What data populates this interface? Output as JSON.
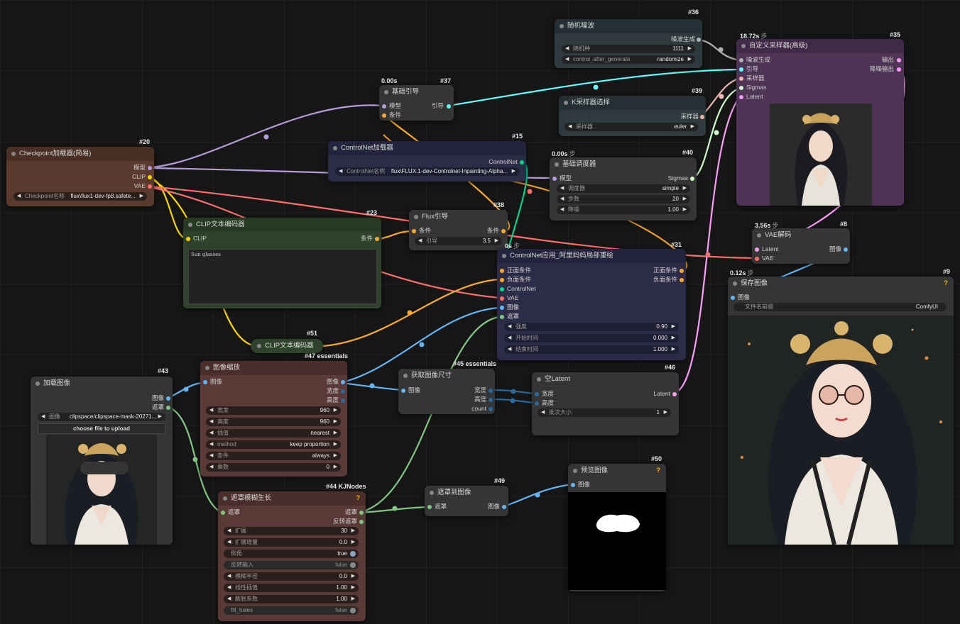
{
  "nodes": {
    "n36": {
      "id": "#36",
      "title": "随机噪波",
      "out1": "噪波生成",
      "w_seed_label": "随机种",
      "w_seed_value": "1111",
      "w_cag_label": "control_after_generate",
      "w_cag_value": "randomize"
    },
    "n35": {
      "id": "#35",
      "time": "18.72s",
      "time_unit": "步",
      "title": "自定义采样器(高级)",
      "in": [
        "噪波生成",
        "引导",
        "采样器",
        "Sigmas",
        "Latent"
      ],
      "out": [
        "输出",
        "降噪输出"
      ]
    },
    "n37": {
      "id": "#37",
      "time": "0.00s",
      "title": "基础引导",
      "in": [
        "模型",
        "条件"
      ],
      "out": "引导"
    },
    "n39": {
      "id": "#39",
      "title": "K采样器选择",
      "out": "采样器",
      "w_label": "采样器",
      "w_value": "euler"
    },
    "n20": {
      "id": "#20",
      "title": "Checkpoint加载器(简易)",
      "out": [
        "模型",
        "CLIP",
        "VAE"
      ],
      "w_label": "Checkpoint名称",
      "w_value": "flux\\flux1-dev-fp8.safete..."
    },
    "n15": {
      "id": "#15",
      "title": "ControlNet加载器",
      "out": "ControlNet",
      "w_label": "ControlNet名称",
      "w_value": "flux\\FLUX.1-dev-Controlnet-Inpainting-Alpha..."
    },
    "n40": {
      "id": "#40",
      "time": "0.00s",
      "time_unit": "步",
      "title": "基础调度器",
      "in": "模型",
      "out": "Sigmas",
      "w": [
        {
          "l": "调度器",
          "v": "simple"
        },
        {
          "l": "步数",
          "v": "20"
        },
        {
          "l": "降噪",
          "v": "1.00"
        }
      ]
    },
    "n23": {
      "id": "#23",
      "title": "CLIP文本编码器",
      "in": "CLIP",
      "out": "条件",
      "text": "Sun glasses"
    },
    "n38": {
      "id": "#38",
      "title": "Flux引导",
      "in": "条件",
      "out": "条件",
      "w_label": "引导",
      "w_value": "3.5"
    },
    "n8": {
      "id": "#8",
      "time": "3.56s",
      "time_unit": "步",
      "title": "VAE解码",
      "in": [
        "Latent",
        "VAE"
      ],
      "out": "图像"
    },
    "n31": {
      "id": "#31",
      "time": "0s",
      "time_unit": "步",
      "title": "ControlNet应用_阿里妈妈局部重绘",
      "in": [
        "正面条件",
        "负面条件",
        "ControlNet",
        "VAE",
        "图像",
        "遮罩"
      ],
      "out": [
        "正面条件",
        "负面条件"
      ],
      "w": [
        {
          "l": "强度",
          "v": "0.90"
        },
        {
          "l": "开始时间",
          "v": "0.000"
        },
        {
          "l": "结束时间",
          "v": "1.000"
        }
      ]
    },
    "n9": {
      "id": "#9",
      "time": "0.12s",
      "time_unit": "步",
      "title": "保存图像",
      "in": "图像",
      "w_label": "文件名前缀",
      "w_value": "ComfyUI",
      "q": "?"
    },
    "n51": {
      "id": "#51",
      "title": "CLIP文本编码器"
    },
    "n47": {
      "id": "#47 essentials",
      "title": "图像缩放",
      "in": "图像",
      "out": [
        "图像",
        "宽度",
        "高度"
      ],
      "w": [
        {
          "l": "宽度",
          "v": "960"
        },
        {
          "l": "高度",
          "v": "960"
        },
        {
          "l": "插值",
          "v": "nearest"
        },
        {
          "l": "method",
          "v": "keep proportion"
        },
        {
          "l": "条件",
          "v": "always"
        },
        {
          "l": "乘数",
          "v": "0"
        }
      ]
    },
    "n45": {
      "id": "#45 essentials",
      "title": "获取图像尺寸",
      "in": "图像",
      "out": [
        "宽度",
        "高度",
        "count"
      ]
    },
    "n46": {
      "id": "#46",
      "title": "空Latent",
      "in": [
        "宽度",
        "高度"
      ],
      "out": "Latent",
      "w_label": "批次大小",
      "w_value": "1"
    },
    "n43": {
      "id": "#43",
      "title": "加载图像",
      "out": [
        "图像",
        "遮罩"
      ],
      "w_label": "图像",
      "w_value": "clipspace/clipspace-mask-20271...",
      "btn": "choose file to upload"
    },
    "n44": {
      "id": "#44 KJNodes",
      "title": "遮罩模糊生长",
      "in": "遮罩",
      "out": [
        "遮罩",
        "反转遮罩"
      ],
      "q": "?",
      "w": [
        {
          "l": "扩展",
          "v": "30"
        },
        {
          "l": "扩展增量",
          "v": "0.0"
        },
        {
          "l": "倒角",
          "v": "true"
        },
        {
          "l": "反转输入",
          "v": "false"
        },
        {
          "l": "模糊半径",
          "v": "0.0"
        },
        {
          "l": "线性插值",
          "v": "1.00"
        },
        {
          "l": "膨胀系数",
          "v": "1.00"
        },
        {
          "l": "fill_holes",
          "v": "false"
        }
      ]
    },
    "n49": {
      "id": "#49",
      "title": "遮罩到图像",
      "in": "遮罩",
      "out": "图像"
    },
    "n50": {
      "id": "#50",
      "title": "预览图像",
      "in": "图像",
      "q": "?"
    }
  },
  "colors": {
    "model": "#b39ddb",
    "clip": "#ffd500",
    "vae": "#ff6e6e",
    "cond": "#ffa931",
    "image": "#64b5f6",
    "mask": "#81c784",
    "latent": "#ff9cf9",
    "guider": "#66ffff",
    "sampler": "#ecb4b4",
    "sigmas": "#cdffcd",
    "noise": "#b0b0b0",
    "int": "#29699c",
    "controlnet": "#00d78d"
  }
}
